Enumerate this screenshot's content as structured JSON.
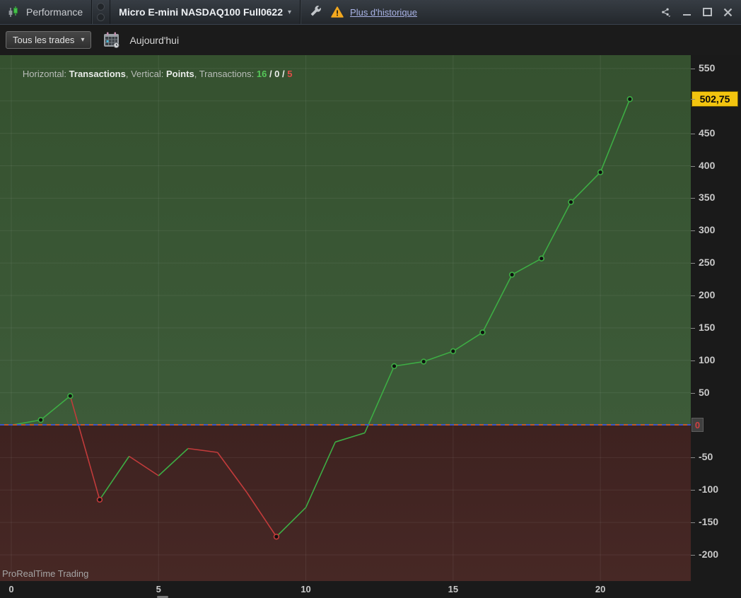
{
  "titlebar": {
    "tab_label": "Performance",
    "instrument": "Micro E-mini NASDAQ100 Full0622",
    "dropdown_caret": "▾",
    "history_link": "Plus d'historique"
  },
  "toolbar": {
    "trades_filter_label": "Tous les trades",
    "trades_filter_caret": "▾",
    "date_label": "Aujourd'hui"
  },
  "legend": {
    "h_label": "Horizontal: ",
    "h_value": "Transactions",
    "sep1": ", ",
    "v_label": "Vertical: ",
    "v_value": "Points",
    "sep2": ", ",
    "t_label": "Transactions: ",
    "wins": "16",
    "slash1": " / ",
    "neutral": "0",
    "slash2": " / ",
    "losses": "5"
  },
  "watermark": "ProRealTime Trading",
  "chart_data": {
    "type": "line",
    "xlabel": "Transactions",
    "ylabel": "Points",
    "x": [
      0,
      1,
      2,
      3,
      4,
      5,
      6,
      7,
      8,
      9,
      10,
      11,
      12,
      13,
      14,
      15,
      16,
      17,
      18,
      19,
      20,
      21
    ],
    "values": [
      0,
      8,
      45,
      -115,
      -48,
      -78,
      -36,
      -42,
      -104,
      -172,
      -127,
      -26,
      -12,
      91,
      98,
      114,
      143,
      232,
      257,
      344,
      390,
      502.75
    ],
    "marker_points": [
      1,
      2,
      3,
      9,
      13,
      14,
      15,
      16,
      17,
      18,
      19,
      20,
      21
    ],
    "wins": 16,
    "breakeven": 0,
    "losses": 5,
    "x_ticks": [
      0,
      5,
      10,
      15,
      20
    ],
    "y_ticks": [
      550,
      450,
      400,
      350,
      300,
      250,
      200,
      150,
      100,
      50,
      -50,
      -100,
      -150,
      -200
    ],
    "grid_y_min": -200,
    "grid_y_max": 550,
    "grid_y_step": 50,
    "xlim": [
      -0.384,
      23.07
    ],
    "ylim": [
      -240.4,
      570.6
    ],
    "last_value": 502.75,
    "last_value_label": "502,75",
    "zero_line_value": 0,
    "zero_badge_label": "0",
    "legend_position": "top-left",
    "grid": true,
    "colors": {
      "gain_line": "#3dad44",
      "loss_line": "#c23b3b",
      "marker_fill": "#101010",
      "gain_bg": "#3a5737",
      "loss_bg": "#3f2220",
      "grid_line": "rgba(255,255,255,0.07)",
      "value_badge_bg": "#f2c40f",
      "zero_dash_blue": "#3b57c8",
      "zero_dash_orange": "#bf5a2c"
    }
  }
}
